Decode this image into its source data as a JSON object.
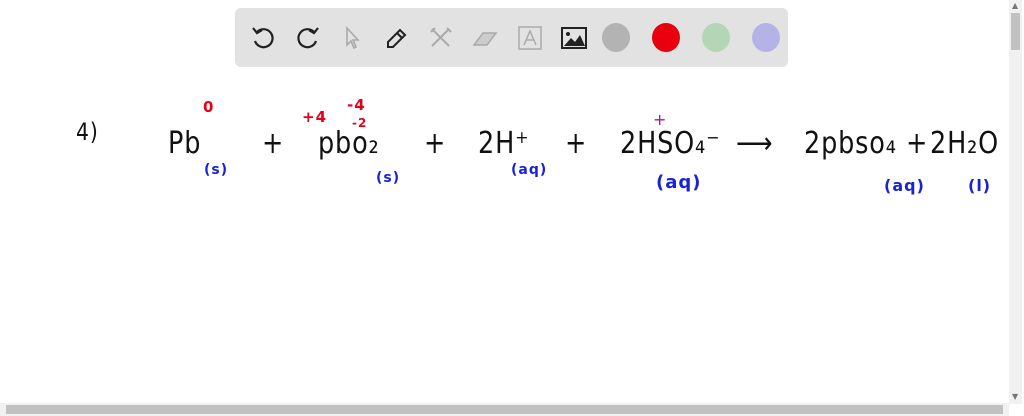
{
  "toolbar": {
    "tools": [
      "undo-icon",
      "redo-icon",
      "select-icon",
      "pen-icon",
      "tools-icon",
      "eraser-icon",
      "text-icon",
      "image-icon"
    ],
    "colors": [
      "#b3b3b3",
      "#e8000f",
      "#b5d6b4",
      "#b5b3e6"
    ]
  },
  "equation": {
    "number": "4)",
    "pb": "Pb",
    "pb_state": "(s)",
    "pb_ox": "0",
    "plus1": "+",
    "pbo2": "pbo₂",
    "pbo2_state": "(s)",
    "pbo2_ox_pb": "+4",
    "pbo2_ox_o_total": "-4",
    "pbo2_ox_o": "-2",
    "plus2": "+",
    "h": "2H⁺",
    "h_state": "(aq)",
    "plus3": "+",
    "hso4": "2HSO₄⁻",
    "hso4_mark": "+",
    "hso4_state": "(aq)",
    "arrow": "⟶",
    "pbso4": "2pbso₄",
    "pbso4_state": "(aq)",
    "plus4": "+",
    "h2o": "2H₂O",
    "h2o_state": "(l)"
  }
}
